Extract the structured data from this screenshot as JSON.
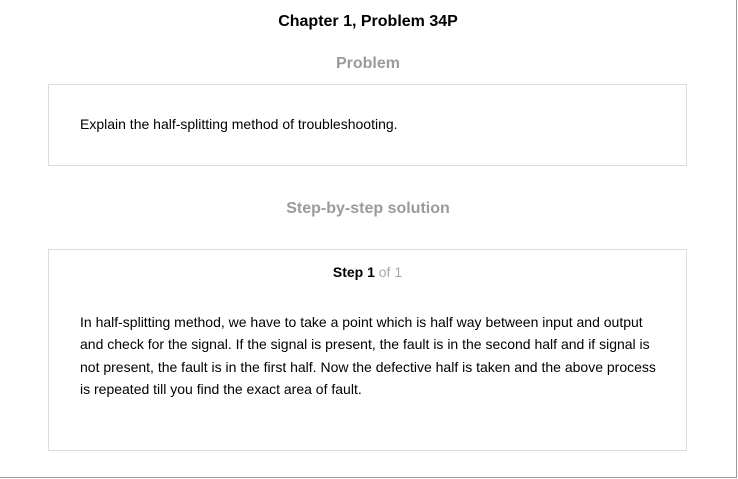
{
  "header": {
    "title": "Chapter 1, Problem 34P"
  },
  "problem": {
    "heading": "Problem",
    "text": "Explain the half-splitting method of troubleshooting."
  },
  "solution": {
    "heading": "Step-by-step solution",
    "step": {
      "label": "Step 1",
      "of": "of 1",
      "text": "In half-splitting method, we have to take a point which is half way between input and output and check for the signal. If the signal is present, the fault is in the second half and if signal is not present, the fault is in the first half. Now the defective half is taken and the above process is repeated till you find the exact area of fault."
    }
  },
  "colors": {
    "heading_gray": "#9b9b9b",
    "box_border": "#dcdcdc",
    "step_of_gray": "#a6a6a6"
  }
}
